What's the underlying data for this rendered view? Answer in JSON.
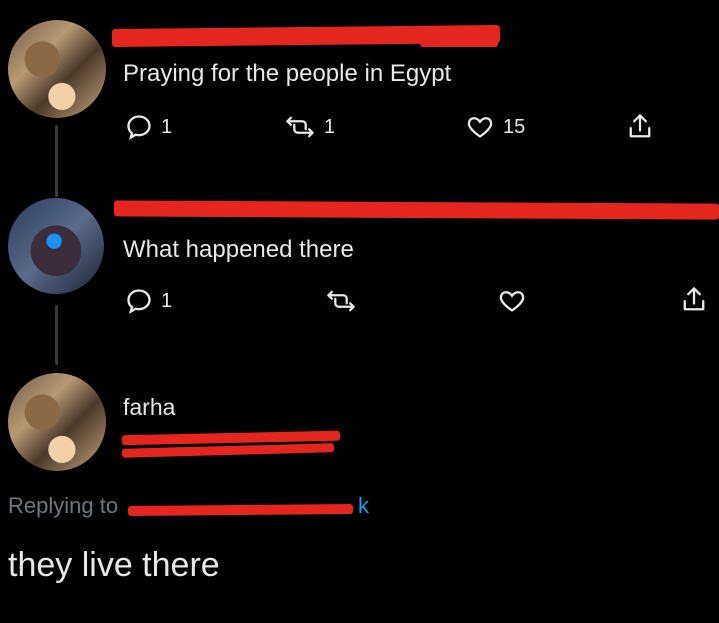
{
  "tweets": [
    {
      "text": "Praying for the people in Egypt",
      "stats": {
        "replies": "1",
        "retweets": "1",
        "likes": "15"
      }
    },
    {
      "text": "What happened there",
      "stats": {
        "replies": "1"
      }
    }
  ],
  "reply": {
    "display_name": "farha",
    "replying_label": "Replying to",
    "mention_tail": "k",
    "text": "they live there"
  },
  "icons": {
    "reply": "reply-icon",
    "retweet": "retweet-icon",
    "like": "heart-icon",
    "share": "share-icon"
  },
  "colors": {
    "background": "#000000",
    "text": "#e8e8e8",
    "muted": "#8b98a5",
    "redaction": "#e5261e",
    "mention": "#1d9bf0"
  }
}
